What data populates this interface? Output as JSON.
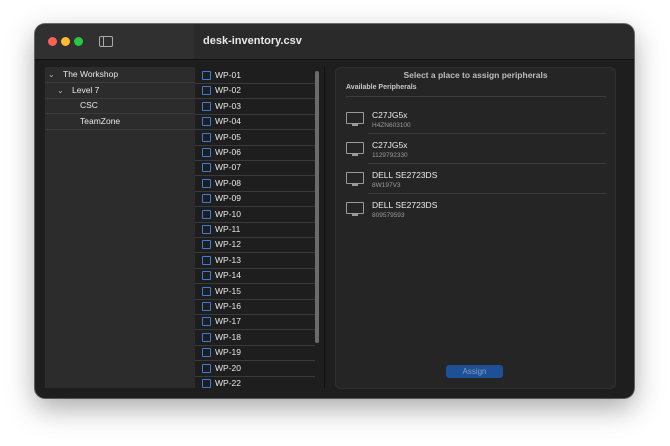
{
  "window": {
    "title": "desk-inventory.csv"
  },
  "tree": {
    "items": [
      {
        "label": "The Workshop",
        "expandable": true
      },
      {
        "label": "Level 7",
        "expandable": true
      },
      {
        "label": "CSC",
        "expandable": false
      },
      {
        "label": "TeamZone",
        "expandable": false
      }
    ]
  },
  "desks": [
    "WP-01",
    "WP-02",
    "WP-03",
    "WP-04",
    "WP-05",
    "WP-06",
    "WP-07",
    "WP-08",
    "WP-09",
    "WP-10",
    "WP-11",
    "WP-12",
    "WP-13",
    "WP-14",
    "WP-15",
    "WP-16",
    "WP-17",
    "WP-18",
    "WP-19",
    "WP-20",
    "WP-22"
  ],
  "panel": {
    "title": "Select a place to assign peripherals",
    "section_label": "Available Peripherals",
    "peripherals": [
      {
        "name": "C27JG5x",
        "serial": "H4ZN603100",
        "icon": "monitor-icon"
      },
      {
        "name": "C27JG5x",
        "serial": "1129792330",
        "icon": "monitor-icon"
      },
      {
        "name": "DELL SE2723DS",
        "serial": "8W197V3",
        "icon": "monitor-icon"
      },
      {
        "name": "DELL SE2723DS",
        "serial": "809579593",
        "icon": "monitor-icon"
      }
    ],
    "assign_label": "Assign"
  },
  "colors": {
    "accent": "#3d7bd9",
    "button": "#1f4f95",
    "window_bg": "#1e1e1e"
  }
}
